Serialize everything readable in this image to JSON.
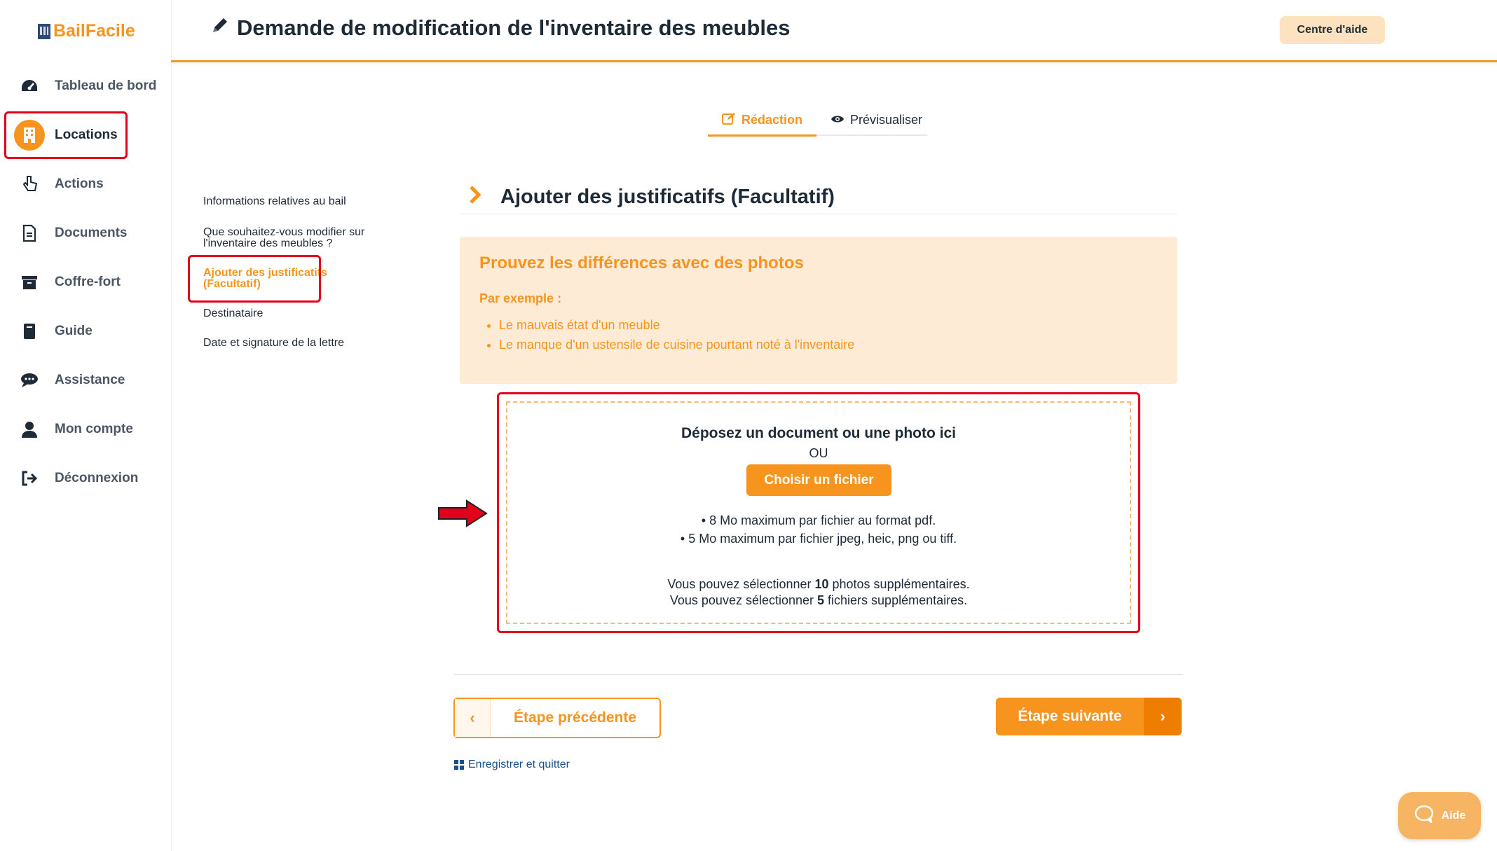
{
  "brand": {
    "name": "BailFacile"
  },
  "sidebar": {
    "items": [
      {
        "label": "Tableau de bord",
        "icon": "speedometer-icon"
      },
      {
        "label": "Locations",
        "icon": "building-icon",
        "active": true
      },
      {
        "label": "Actions",
        "icon": "pointer-hand-icon"
      },
      {
        "label": "Documents",
        "icon": "document-icon"
      },
      {
        "label": "Coffre-fort",
        "icon": "archive-box-icon"
      },
      {
        "label": "Guide",
        "icon": "book-icon"
      },
      {
        "label": "Assistance",
        "icon": "chat-bubble-icon"
      },
      {
        "label": "Mon compte",
        "icon": "user-icon"
      },
      {
        "label": "Déconnexion",
        "icon": "logout-icon"
      }
    ]
  },
  "header": {
    "title": "Demande de modification de l'inventaire des meubles",
    "help_label": "Centre d'aide"
  },
  "tabs": [
    {
      "label": "Rédaction",
      "active": true
    },
    {
      "label": "Prévisualiser",
      "active": false
    }
  ],
  "steps": [
    {
      "label": "Informations relatives au bail"
    },
    {
      "label": "Que souhaitez-vous modifier sur l'inventaire des meubles ?"
    },
    {
      "label": "Ajouter des justificatifs (Facultatif)",
      "active": true
    },
    {
      "label": "Destinataire"
    },
    {
      "label": "Date et signature de la lettre"
    }
  ],
  "section": {
    "title": "Ajouter des justificatifs (Facultatif)"
  },
  "info": {
    "heading": "Prouvez les différences avec des photos",
    "example_label": "Par exemple :",
    "examples": [
      "Le mauvais état d'un meuble",
      "Le manque d'un ustensile de cuisine pourtant noté à l'inventaire"
    ]
  },
  "upload": {
    "title": "Déposez un document ou une photo ici",
    "or": "OU",
    "button": "Choisir un fichier",
    "limit_pdf": "• 8 Mo maximum par fichier au format pdf.",
    "limit_img": "• 5 Mo maximum par fichier jpeg, heic, png ou tiff.",
    "photos_prefix": "Vous pouvez sélectionner ",
    "photos_count": "10",
    "photos_suffix": " photos supplémentaires.",
    "files_prefix": "Vous pouvez sélectionner ",
    "files_count": "5",
    "files_suffix": " fichiers supplémentaires."
  },
  "nav_buttons": {
    "prev": "Étape précédente",
    "next": "Étape suivante",
    "save": "Enregistrer et quitter"
  },
  "chat": {
    "label": "Aide"
  },
  "colors": {
    "accent": "#f7941d",
    "highlight": "#e3001b",
    "info_bg": "#fdebd6"
  }
}
